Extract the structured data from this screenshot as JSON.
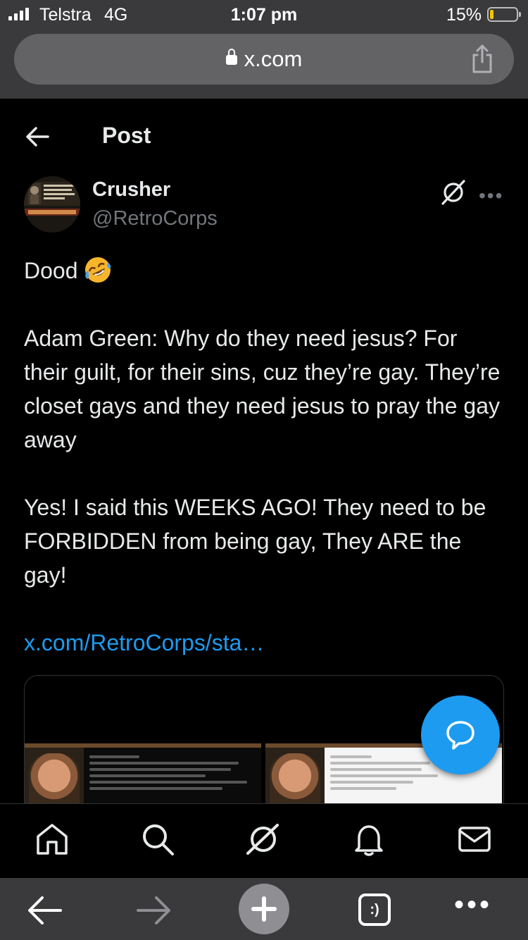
{
  "status_bar": {
    "carrier": "Telstra",
    "network": "4G",
    "time": "1:07 pm",
    "battery_percent": "15%",
    "battery_level": 0.15
  },
  "browser": {
    "url": "x.com",
    "icons": [
      "lock-icon",
      "share-icon"
    ]
  },
  "header": {
    "title": "Post",
    "back_icon": "back-arrow-icon"
  },
  "post": {
    "author_name": "Crusher",
    "author_handle": "@RetroCorps",
    "paragraphs": [
      "Dood",
      "Adam Green: Why do they need jesus? For their guilt, for their sins, cuz they’re gay. They’re closet gays and they need jesus to pray the gay away",
      "Yes! I said this WEEKS AGO! They need to be FORBIDDEN from being gay, They ARE the gay!"
    ],
    "emoji": "rolling-on-floor-laughing-emoji",
    "link": "x.com/RetroCorps/sta…",
    "more_label": "•••"
  },
  "tab_bar": {
    "items": [
      "home-icon",
      "search-icon",
      "grok-icon",
      "notifications-icon",
      "messages-icon"
    ]
  },
  "browser_toolbar": {
    "tabs_label": ":)",
    "more_label": "•••"
  },
  "colors": {
    "background": "#000000",
    "accent": "#1d9bf0",
    "text": "#e7e9ea",
    "secondary_text": "#71767b",
    "browser_chrome": "#3a3a3c"
  }
}
